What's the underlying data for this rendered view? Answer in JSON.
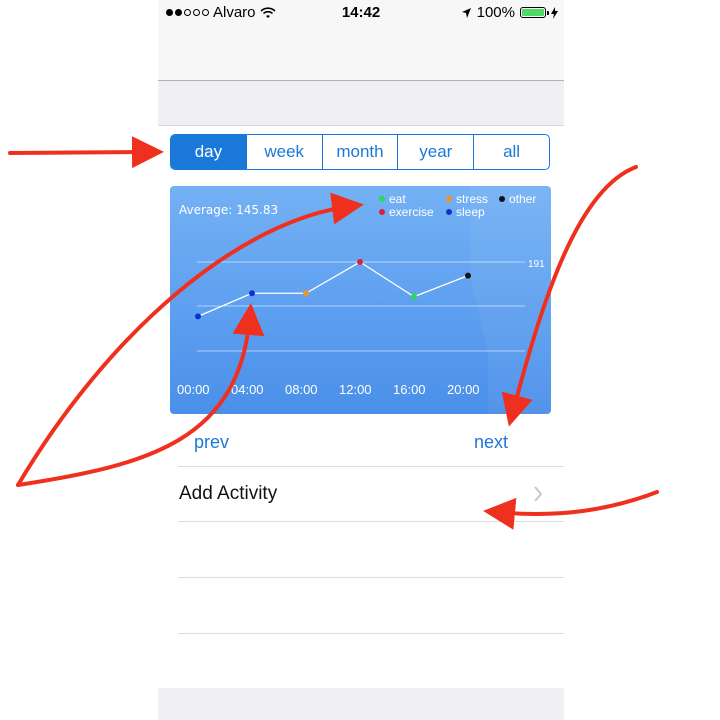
{
  "status_bar": {
    "carrier": "Alvaro",
    "time": "14:42",
    "battery": "100%",
    "signal_dots": [
      true,
      true,
      false,
      false,
      false
    ]
  },
  "segmented_control": {
    "selected": "day",
    "items": [
      "day",
      "week",
      "month",
      "year",
      "all"
    ]
  },
  "chart": {
    "average_label": "Average: 145.83",
    "legend": [
      {
        "label": "eat",
        "color": "#22dd55"
      },
      {
        "label": "stress",
        "color": "#f0922a"
      },
      {
        "label": "other",
        "color": "#111111"
      },
      {
        "label": "exercise",
        "color": "#e0203a"
      },
      {
        "label": "sleep",
        "color": "#1030d0"
      }
    ],
    "max_label": "191"
  },
  "chart_data": {
    "type": "line",
    "x_ticks": [
      "00:00",
      "04:00",
      "08:00",
      "12:00",
      "16:00",
      "20:00"
    ],
    "y_max_label": "191",
    "points": [
      {
        "x": "00:00",
        "y": 111,
        "category": "sleep"
      },
      {
        "x": "04:00",
        "y": 145,
        "category": "sleep"
      },
      {
        "x": "08:00",
        "y": 145,
        "category": "stress"
      },
      {
        "x": "12:00",
        "y": 191,
        "category": "exercise"
      },
      {
        "x": "16:00",
        "y": 140,
        "category": "eat"
      },
      {
        "x": "20:00",
        "y": 171,
        "category": "other"
      }
    ],
    "grid": true,
    "legend_position": "top-right",
    "colors": {
      "eat": "#22dd55",
      "stress": "#f0922a",
      "other": "#111111",
      "exercise": "#e0203a",
      "sleep": "#1030d0"
    }
  },
  "pager": {
    "prev": "prev",
    "next": "next"
  },
  "list": {
    "add_activity": "Add Activity"
  },
  "colors": {
    "accent": "#1a79d8",
    "annotation_arrow": "#f0301e"
  }
}
